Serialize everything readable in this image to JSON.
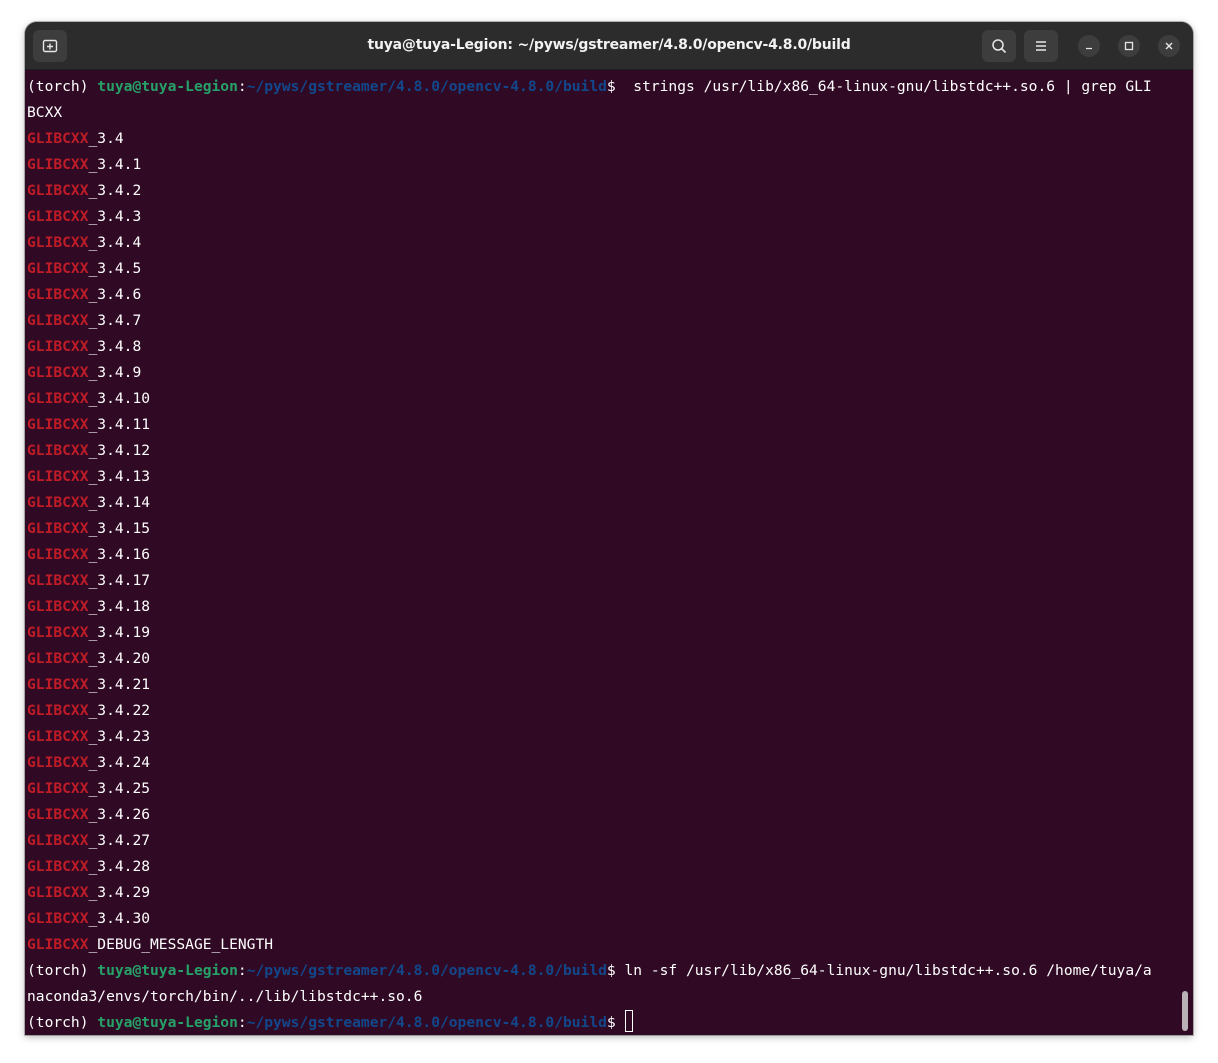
{
  "window": {
    "title": "tuya@tuya-Legion: ~/pyws/gstreamer/4.8.0/opencv-4.8.0/build"
  },
  "toolbar": {
    "new_tab_icon": "new-tab-icon",
    "search_icon": "search-icon",
    "menu_icon": "hamburger-menu-icon",
    "minimize_icon": "minimize-icon",
    "maximize_icon": "maximize-icon",
    "close_icon": "close-icon"
  },
  "colors": {
    "terminal_bg": "#300a24",
    "titlebar_bg": "#2c2c2c",
    "prompt_user": "#26a269",
    "prompt_path": "#12488b",
    "match": "#c01c28",
    "text": "#ffffff"
  },
  "prompt": {
    "env": "(torch) ",
    "user_host": "tuya@tuya-Legion",
    "colon": ":",
    "path": "~/pyws/gstreamer/4.8.0/opencv-4.8.0/build",
    "dollar": "$"
  },
  "commands": {
    "cmd1_line1": "  strings /usr/lib/x86_64-linux-gnu/libstdc++.so.6 | grep GLI",
    "cmd1_line2": "BCXX",
    "cmd2_line1": " ln -sf /usr/lib/x86_64-linux-gnu/libstdc++.so.6 /home/tuya/a",
    "cmd2_line2": "naconda3/envs/torch/bin/../lib/libstdc++.so.6",
    "cmd3": " "
  },
  "output": {
    "match_text": "GLIBCXX",
    "versions": [
      "_3.4",
      "_3.4.1",
      "_3.4.2",
      "_3.4.3",
      "_3.4.4",
      "_3.4.5",
      "_3.4.6",
      "_3.4.7",
      "_3.4.8",
      "_3.4.9",
      "_3.4.10",
      "_3.4.11",
      "_3.4.12",
      "_3.4.13",
      "_3.4.14",
      "_3.4.15",
      "_3.4.16",
      "_3.4.17",
      "_3.4.18",
      "_3.4.19",
      "_3.4.20",
      "_3.4.21",
      "_3.4.22",
      "_3.4.23",
      "_3.4.24",
      "_3.4.25",
      "_3.4.26",
      "_3.4.27",
      "_3.4.28",
      "_3.4.29",
      "_3.4.30",
      "_DEBUG_MESSAGE_LENGTH"
    ]
  }
}
